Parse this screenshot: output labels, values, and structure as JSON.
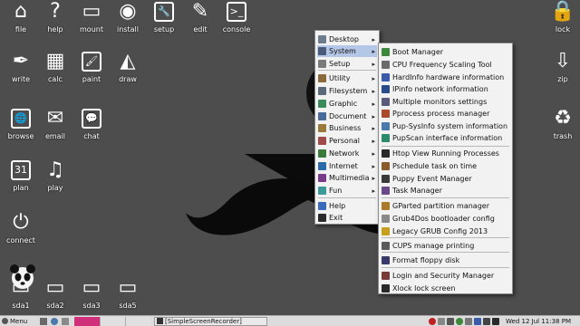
{
  "desktop_left": [
    {
      "label": "file",
      "icon": "house-icon",
      "glyph": "⌂"
    },
    {
      "label": "help",
      "icon": "question-icon",
      "glyph": "?"
    },
    {
      "label": "mount",
      "icon": "drive-icon",
      "glyph": "▭"
    },
    {
      "label": "install",
      "icon": "disc-icon",
      "glyph": "◉"
    },
    {
      "label": "setup",
      "icon": "wrench-icon",
      "glyph": "🔧"
    },
    {
      "label": "edit",
      "icon": "notepad-icon",
      "glyph": "✎"
    },
    {
      "label": "console",
      "icon": "terminal-icon",
      "glyph": ">_"
    },
    {
      "label": "write",
      "icon": "pen-icon",
      "glyph": "✒"
    },
    {
      "label": "calc",
      "icon": "spreadsheet-icon",
      "glyph": "▦"
    },
    {
      "label": "paint",
      "icon": "brush-icon",
      "glyph": "🖌"
    },
    {
      "label": "draw",
      "icon": "draw-icon",
      "glyph": "◭"
    },
    {
      "label": "browse",
      "icon": "globe-icon",
      "glyph": "🌐"
    },
    {
      "label": "email",
      "icon": "envelope-icon",
      "glyph": "✉"
    },
    {
      "label": "chat",
      "icon": "chat-bubble-icon",
      "glyph": "💬"
    },
    {
      "label": "plan",
      "icon": "calendar-icon",
      "glyph": "31"
    },
    {
      "label": "play",
      "icon": "music-note-icon",
      "glyph": "♫"
    },
    {
      "label": "connect",
      "icon": "plug-icon",
      "glyph": "⏻"
    },
    {
      "label": "sda1",
      "icon": "drive-icon",
      "glyph": "▭"
    },
    {
      "label": "sda2",
      "icon": "drive-icon",
      "glyph": "▭"
    },
    {
      "label": "sda3",
      "icon": "drive-icon",
      "glyph": "▭"
    },
    {
      "label": "sda5",
      "icon": "drive-icon",
      "glyph": "▭"
    }
  ],
  "desktop_right": [
    {
      "label": "lock",
      "icon": "padlock-icon",
      "glyph": "🔒"
    },
    {
      "label": "zip",
      "icon": "archive-icon",
      "glyph": "⇩"
    },
    {
      "label": "trash",
      "icon": "recycle-bin-icon",
      "glyph": "♻"
    }
  ],
  "menu_left": [
    {
      "label": "Desktop",
      "arrow": "▸",
      "color": "#6d7b8d"
    },
    {
      "label": "System",
      "arrow": "▸",
      "color": "#4a5a7a",
      "selected": true
    },
    {
      "label": "Setup",
      "arrow": "▸",
      "color": "#7a7a7a"
    },
    {
      "label": "Utility",
      "arrow": "▸",
      "color": "#8a6a3a"
    },
    {
      "label": "Filesystem",
      "arrow": "▸",
      "color": "#5a6a7a"
    },
    {
      "label": "Graphic",
      "arrow": "▸",
      "color": "#3a8a5a"
    },
    {
      "label": "Document",
      "arrow": "▸",
      "color": "#4a6a9a"
    },
    {
      "label": "Business",
      "arrow": "▸",
      "color": "#9a7a3a"
    },
    {
      "label": "Personal",
      "arrow": "▸",
      "color": "#a04a4a"
    },
    {
      "label": "Network",
      "arrow": "▸",
      "color": "#3a7a3a"
    },
    {
      "label": "Internet",
      "arrow": "▸",
      "color": "#2a6aaa"
    },
    {
      "label": "Multimedia",
      "arrow": "▸",
      "color": "#7a3a8a"
    },
    {
      "label": "Fun",
      "arrow": "▸",
      "color": "#3a9a9a"
    },
    {
      "label": "Help",
      "arrow": "",
      "color": "#3a6aba"
    },
    {
      "label": "Exit",
      "arrow": "",
      "color": "#2a2a2a"
    }
  ],
  "menu_right": [
    {
      "label": "Boot Manager",
      "color": "#3a8a3a"
    },
    {
      "label": "CPU Frequency Scaling Tool",
      "color": "#6a6a6a"
    },
    {
      "label": "HardInfo hardware information",
      "color": "#3a5aaa"
    },
    {
      "label": "IPinfo network information",
      "color": "#2a4a8a"
    },
    {
      "label": "Multiple monitors settings",
      "color": "#5a5a7a"
    },
    {
      "label": "Pprocess process manager",
      "color": "#aa4a2a"
    },
    {
      "label": "Pup-SysInfo system information",
      "color": "#4a7aaa"
    },
    {
      "label": "PupScan interface information",
      "color": "#2a8a6a"
    },
    {
      "label": "Htop View Running Processes",
      "color": "#2a2a2a"
    },
    {
      "label": "Pschedule task on time",
      "color": "#8a5a2a"
    },
    {
      "label": "Puppy Event Manager",
      "color": "#3a3a3a"
    },
    {
      "label": "Task Manager",
      "color": "#6a4a8a"
    },
    {
      "label": "GParted partition manager",
      "color": "#aa7a2a"
    },
    {
      "label": "Grub4Dos bootloader config",
      "color": "#8a8a8a"
    },
    {
      "label": "Legacy GRUB Config 2013",
      "color": "#c8a020"
    },
    {
      "label": "CUPS manage printing",
      "color": "#5a5a5a"
    },
    {
      "label": "Format floppy disk",
      "color": "#3a3a6a"
    },
    {
      "label": "Login and Security Manager",
      "color": "#7a3a3a"
    },
    {
      "label": "Xlock lock screen",
      "color": "#2a2a2a"
    }
  ],
  "taskbar": {
    "menu_label": "Menu",
    "task_label": "[SimpleScreenRecorder]",
    "clock": "Wed 12 Jul 11:38 PM"
  }
}
